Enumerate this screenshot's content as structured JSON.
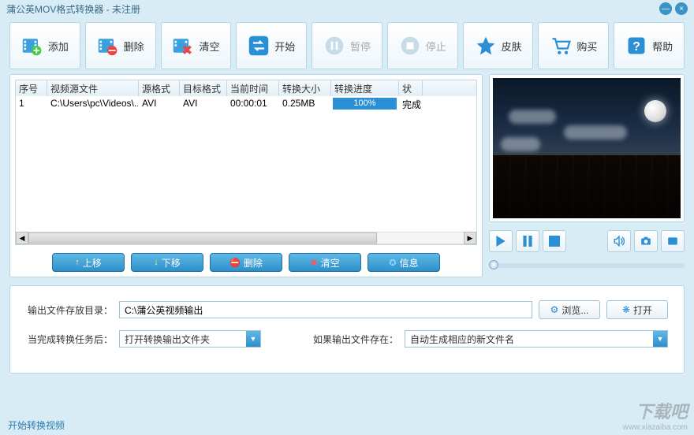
{
  "title": "蒲公英MOV格式转换器 - 未注册",
  "toolbar": {
    "add": "添加",
    "delete": "删除",
    "clear": "清空",
    "start": "开始",
    "pause": "暂停",
    "stop": "停止",
    "skin": "皮肤",
    "buy": "购买",
    "help": "帮助"
  },
  "table": {
    "headers": {
      "seq": "序号",
      "source": "视频源文件",
      "srcfmt": "源格式",
      "dstfmt": "目标格式",
      "time": "当前时间",
      "size": "转换大小",
      "progress": "转换进度",
      "status": "状"
    },
    "rows": [
      {
        "seq": "1",
        "source": "C:\\Users\\pc\\Videos\\...",
        "srcfmt": "AVI",
        "dstfmt": "AVI",
        "time": "00:00:01",
        "size": "0.25MB",
        "progress": "100%",
        "status": "完成"
      }
    ]
  },
  "rowbtns": {
    "up": "上移",
    "down": "下移",
    "delete": "删除",
    "clear": "清空",
    "info": "信息"
  },
  "output": {
    "dir_label": "输出文件存放目录：",
    "dir_value": "C:\\蒲公英视频输出",
    "browse": "浏览...",
    "open": "打开",
    "after_label": "当完成转换任务后：",
    "after_value": "打开转换输出文件夹",
    "exist_label": "如果输出文件存在：",
    "exist_value": "自动生成相应的新文件名"
  },
  "status": "开始转换视频",
  "watermark": {
    "big": "下载吧",
    "small": "www.xiazaiba.com"
  }
}
